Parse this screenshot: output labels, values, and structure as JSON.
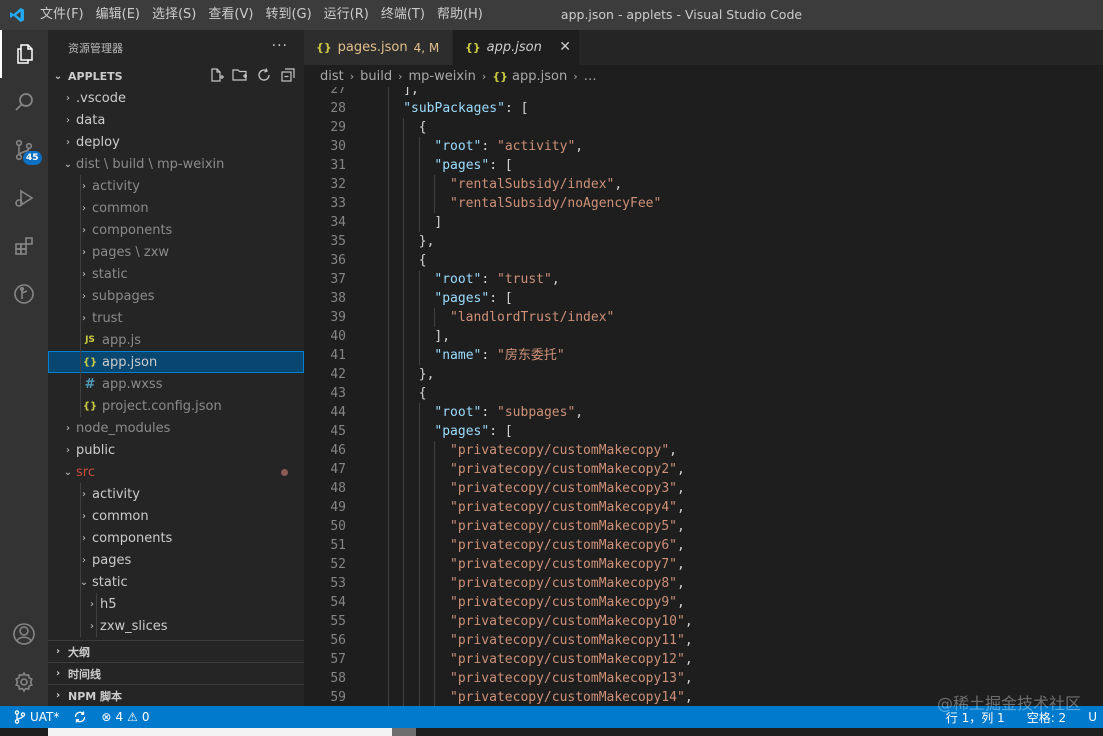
{
  "titlebar": {
    "menu": [
      "文件(F)",
      "编辑(E)",
      "选择(S)",
      "查看(V)",
      "转到(G)",
      "运行(R)",
      "终端(T)",
      "帮助(H)"
    ],
    "window_title": "app.json - applets - Visual Studio Code"
  },
  "activitybar": {
    "icons": [
      "explorer-icon",
      "search-icon",
      "source-control-icon",
      "run-debug-icon",
      "extensions-icon",
      "remote-icon",
      "account-icon",
      "settings-gear-icon"
    ],
    "scm_badge": "45"
  },
  "sidebar": {
    "title": "资源管理器",
    "more": "···",
    "project": "APPLETS",
    "tree": [
      {
        "label": ".vscode",
        "depth": 0,
        "chev": "›",
        "type": "folder"
      },
      {
        "label": "data",
        "depth": 0,
        "chev": "›",
        "type": "folder"
      },
      {
        "label": "deploy",
        "depth": 0,
        "chev": "›",
        "type": "folder"
      },
      {
        "label": "dist \\ build \\ mp-weixin",
        "depth": 0,
        "chev": "⌄",
        "type": "folder-open",
        "muted": true
      },
      {
        "label": "activity",
        "depth": 1,
        "chev": "›",
        "type": "folder",
        "muted": true
      },
      {
        "label": "common",
        "depth": 1,
        "chev": "›",
        "type": "folder",
        "muted": true
      },
      {
        "label": "components",
        "depth": 1,
        "chev": "›",
        "type": "folder",
        "muted": true
      },
      {
        "label": "pages \\ zxw",
        "depth": 1,
        "chev": "›",
        "type": "folder",
        "muted": true
      },
      {
        "label": "static",
        "depth": 1,
        "chev": "›",
        "type": "folder",
        "muted": true
      },
      {
        "label": "subpages",
        "depth": 1,
        "chev": "›",
        "type": "folder",
        "muted": true
      },
      {
        "label": "trust",
        "depth": 1,
        "chev": "›",
        "type": "folder",
        "muted": true
      },
      {
        "label": "app.js",
        "depth": 1,
        "chev": "",
        "type": "js",
        "muted": true
      },
      {
        "label": "app.json",
        "depth": 1,
        "chev": "",
        "type": "json",
        "selected": true
      },
      {
        "label": "app.wxss",
        "depth": 1,
        "chev": "",
        "type": "css",
        "muted": true
      },
      {
        "label": "project.config.json",
        "depth": 1,
        "chev": "",
        "type": "json",
        "muted": true
      },
      {
        "label": "node_modules",
        "depth": 0,
        "chev": "›",
        "type": "folder",
        "muted": true
      },
      {
        "label": "public",
        "depth": 0,
        "chev": "›",
        "type": "folder"
      },
      {
        "label": "src",
        "depth": 0,
        "chev": "⌄",
        "type": "folder-open",
        "modified": true
      },
      {
        "label": "activity",
        "depth": 1,
        "chev": "›",
        "type": "folder"
      },
      {
        "label": "common",
        "depth": 1,
        "chev": "›",
        "type": "folder"
      },
      {
        "label": "components",
        "depth": 1,
        "chev": "›",
        "type": "folder"
      },
      {
        "label": "pages",
        "depth": 1,
        "chev": "›",
        "type": "folder"
      },
      {
        "label": "static",
        "depth": 1,
        "chev": "⌄",
        "type": "folder-open"
      },
      {
        "label": "h5",
        "depth": 2,
        "chev": "›",
        "type": "folder"
      },
      {
        "label": "zxw_slices",
        "depth": 2,
        "chev": "›",
        "type": "folder"
      }
    ],
    "bottom_sections": [
      "大纲",
      "时间线",
      "NPM 脚本"
    ]
  },
  "tabs": [
    {
      "label": "pages.json",
      "status": "4, M",
      "active": false
    },
    {
      "label": "app.json",
      "status": "",
      "active": true
    }
  ],
  "breadcrumb": [
    "dist",
    "build",
    "mp-weixin",
    "app.json",
    "…"
  ],
  "code_lines": [
    {
      "n": "27",
      "indent": 2,
      "text": "],",
      "kind": "punct"
    },
    {
      "n": "28",
      "indent": 2,
      "key": "\"subPackages\"",
      "rest": ": ["
    },
    {
      "n": "29",
      "indent": 3,
      "text": "{",
      "kind": "punct"
    },
    {
      "n": "30",
      "indent": 4,
      "key": "\"root\"",
      "sep": ": ",
      "str": "\"activity\"",
      "tail": ","
    },
    {
      "n": "31",
      "indent": 4,
      "key": "\"pages\"",
      "rest": ": ["
    },
    {
      "n": "32",
      "indent": 5,
      "str": "\"rentalSubsidy/index\"",
      "tail": ","
    },
    {
      "n": "33",
      "indent": 5,
      "str": "\"rentalSubsidy/noAgencyFee\"",
      "tail": ""
    },
    {
      "n": "34",
      "indent": 4,
      "text": "]",
      "kind": "punct"
    },
    {
      "n": "35",
      "indent": 3,
      "text": "},",
      "kind": "punct"
    },
    {
      "n": "36",
      "indent": 3,
      "text": "{",
      "kind": "punct"
    },
    {
      "n": "37",
      "indent": 4,
      "key": "\"root\"",
      "sep": ": ",
      "str": "\"trust\"",
      "tail": ","
    },
    {
      "n": "38",
      "indent": 4,
      "key": "\"pages\"",
      "rest": ": ["
    },
    {
      "n": "39",
      "indent": 5,
      "str": "\"landlordTrust/index\"",
      "tail": ""
    },
    {
      "n": "40",
      "indent": 4,
      "text": "],",
      "kind": "punct"
    },
    {
      "n": "41",
      "indent": 4,
      "key": "\"name\"",
      "sep": ": ",
      "str": "\"房东委托\"",
      "tail": ""
    },
    {
      "n": "42",
      "indent": 3,
      "text": "},",
      "kind": "punct"
    },
    {
      "n": "43",
      "indent": 3,
      "text": "{",
      "kind": "punct"
    },
    {
      "n": "44",
      "indent": 4,
      "key": "\"root\"",
      "sep": ": ",
      "str": "\"subpages\"",
      "tail": ","
    },
    {
      "n": "45",
      "indent": 4,
      "key": "\"pages\"",
      "rest": ": ["
    },
    {
      "n": "46",
      "indent": 5,
      "str": "\"privatecopy/customMakecopy\"",
      "tail": ","
    },
    {
      "n": "47",
      "indent": 5,
      "str": "\"privatecopy/customMakecopy2\"",
      "tail": ","
    },
    {
      "n": "48",
      "indent": 5,
      "str": "\"privatecopy/customMakecopy3\"",
      "tail": ","
    },
    {
      "n": "49",
      "indent": 5,
      "str": "\"privatecopy/customMakecopy4\"",
      "tail": ","
    },
    {
      "n": "50",
      "indent": 5,
      "str": "\"privatecopy/customMakecopy5\"",
      "tail": ","
    },
    {
      "n": "51",
      "indent": 5,
      "str": "\"privatecopy/customMakecopy6\"",
      "tail": ","
    },
    {
      "n": "52",
      "indent": 5,
      "str": "\"privatecopy/customMakecopy7\"",
      "tail": ","
    },
    {
      "n": "53",
      "indent": 5,
      "str": "\"privatecopy/customMakecopy8\"",
      "tail": ","
    },
    {
      "n": "54",
      "indent": 5,
      "str": "\"privatecopy/customMakecopy9\"",
      "tail": ","
    },
    {
      "n": "55",
      "indent": 5,
      "str": "\"privatecopy/customMakecopy10\"",
      "tail": ","
    },
    {
      "n": "56",
      "indent": 5,
      "str": "\"privatecopy/customMakecopy11\"",
      "tail": ","
    },
    {
      "n": "57",
      "indent": 5,
      "str": "\"privatecopy/customMakecopy12\"",
      "tail": ","
    },
    {
      "n": "58",
      "indent": 5,
      "str": "\"privatecopy/customMakecopy13\"",
      "tail": ","
    },
    {
      "n": "59",
      "indent": 5,
      "str": "\"privatecopy/customMakecopy14\"",
      "tail": ","
    }
  ],
  "statusbar": {
    "branch": "UAT*",
    "errors": "4",
    "warnings": "0",
    "position": "行 1，列 1",
    "spaces": "空格: 2",
    "encoding": "U"
  },
  "watermark": "@稀土掘金技术社区",
  "colors": {
    "accent": "#007acc",
    "selection": "#094771",
    "json_icon": "#cbcb41",
    "modified": "#e2c08d"
  }
}
